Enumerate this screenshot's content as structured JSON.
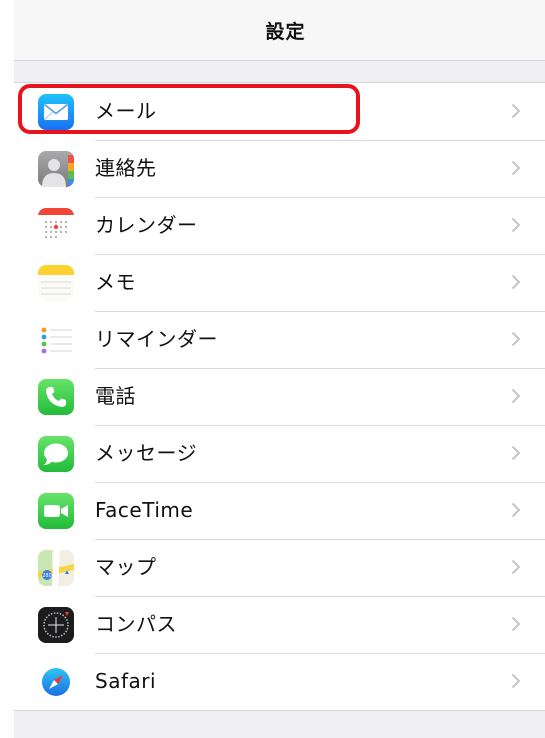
{
  "navbar": {
    "title": "設定"
  },
  "settings": {
    "items": [
      {
        "label": "メール",
        "icon": "mail-icon"
      },
      {
        "label": "連絡先",
        "icon": "contacts-icon"
      },
      {
        "label": "カレンダー",
        "icon": "calendar-icon"
      },
      {
        "label": "メモ",
        "icon": "notes-icon"
      },
      {
        "label": "リマインダー",
        "icon": "reminders-icon"
      },
      {
        "label": "電話",
        "icon": "phone-icon"
      },
      {
        "label": "メッセージ",
        "icon": "messages-icon"
      },
      {
        "label": "FaceTime",
        "icon": "facetime-icon"
      },
      {
        "label": "マップ",
        "icon": "maps-icon"
      },
      {
        "label": "コンパス",
        "icon": "compass-icon"
      },
      {
        "label": "Safari",
        "icon": "safari-icon"
      }
    ]
  },
  "highlight": {
    "color": "#e8141b",
    "target": "mail"
  }
}
